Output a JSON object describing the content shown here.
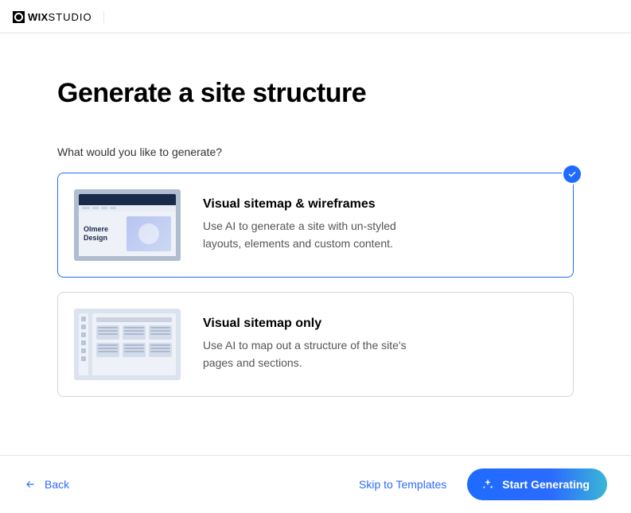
{
  "brand": {
    "part1": "WIX",
    "part2": "STUDIO"
  },
  "page": {
    "title": "Generate a site structure",
    "prompt": "What would you like to generate?"
  },
  "options": [
    {
      "title": "Visual sitemap & wireframes",
      "description": "Use AI to generate a site with un-styled layouts, elements and custom content.",
      "selected": true,
      "illustration": {
        "label1": "Olmere",
        "label2": "Design"
      }
    },
    {
      "title": "Visual sitemap only",
      "description": "Use AI to map out a structure of the site's pages and sections.",
      "selected": false
    }
  ],
  "footer": {
    "back": "Back",
    "skip": "Skip to Templates",
    "start": "Start Generating"
  }
}
